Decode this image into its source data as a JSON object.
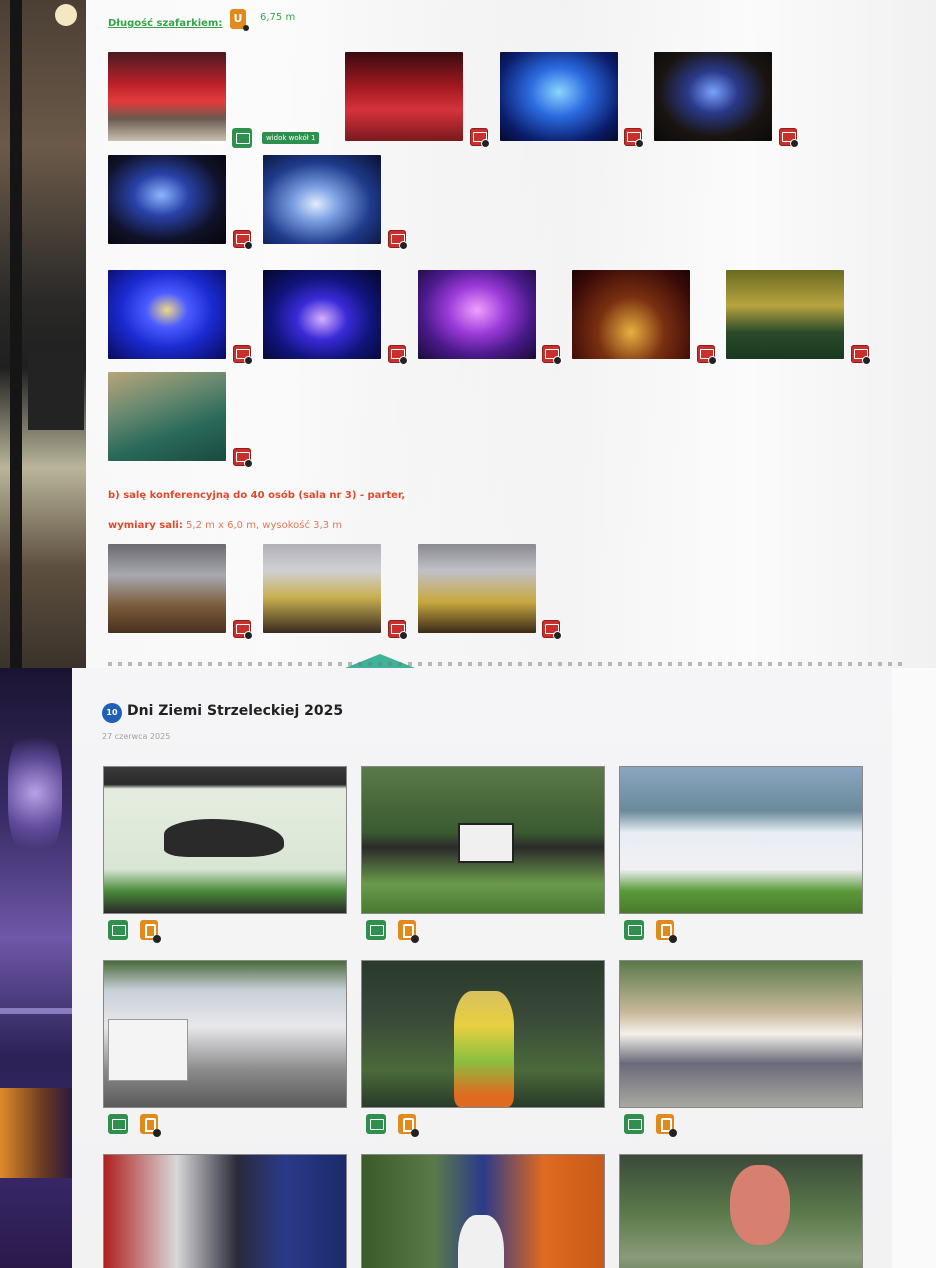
{
  "top_panel": {
    "length_label": "Długość szafarkiem:",
    "length_icon_letter": "U",
    "length_value": "6,75 m",
    "green_tag_text": "widok wokół 1",
    "conference_line1": "b) salę konferencyjną do 40 osób (sala nr 3) - parter,",
    "conference_line2_bold": "wymiary sali:",
    "conference_line2_rest": " 5,2 m x 6,0 m, wysokość 3,3 m",
    "icon_names": {
      "photo": "photo-icon",
      "gallery": "gallery-icon",
      "user": "user-icon"
    }
  },
  "bottom_panel": {
    "badge_text": "10",
    "event_title": "Dni Ziemi Strzeleckiej 2025",
    "event_date": "27 czerwca 2025",
    "colors": {
      "badge": "#1f5fb8",
      "green_icon": "#2f8f4e",
      "orange_icon": "#e08a1c",
      "red_icon": "#c9302c"
    }
  }
}
